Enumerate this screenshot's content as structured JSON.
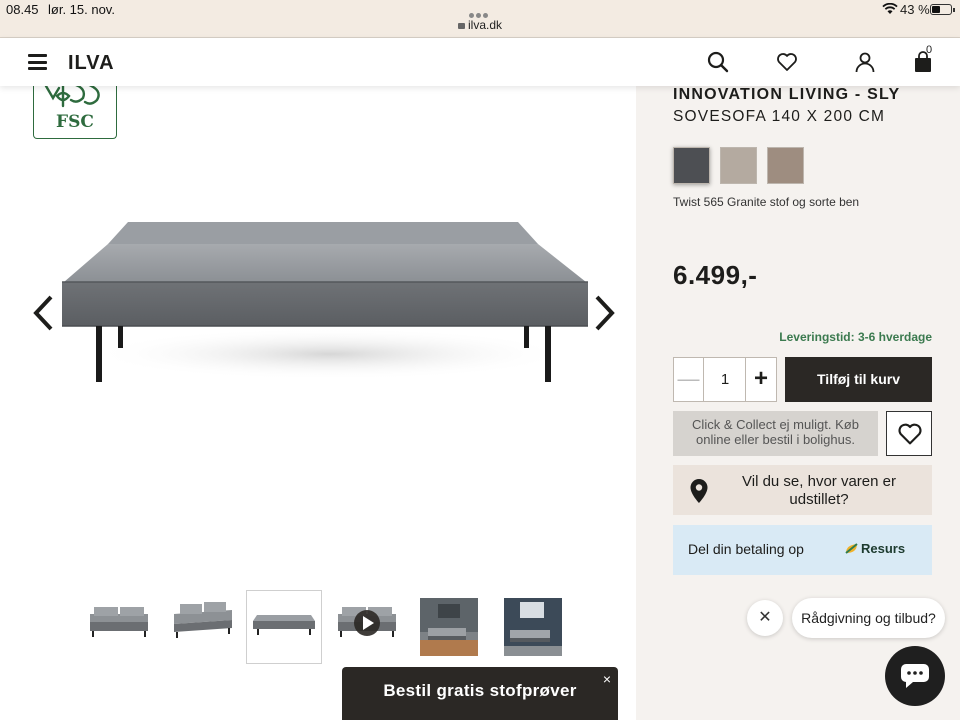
{
  "status": {
    "time": "08.45",
    "date": "lør. 15. nov.",
    "url": "ilva.dk",
    "battery": "43 %"
  },
  "header": {
    "logo": "ILVA",
    "cart_count": "0",
    "icons": [
      "menu-icon",
      "search-icon",
      "heart-icon",
      "user-icon",
      "bag-icon"
    ]
  },
  "gallery": {
    "fsc_label": "FSC",
    "thumbnails": [
      "sofa-front",
      "sofa-angle",
      "sofa-bed-flat",
      "video",
      "room-photo",
      "room-photo-dark"
    ],
    "selected_thumbnail": 2,
    "promo_label": "Bestil gratis stofprøver",
    "promo_close": "×"
  },
  "product": {
    "brand": "INNOVATION LIVING - SLY",
    "title": "SOVESOFA 140 X 200 CM",
    "swatches": [
      "#4d4f53",
      "#b4aaa0",
      "#9e8d80"
    ],
    "color_name": "Twist 565 Granite stof og sorte ben",
    "price": "6.499,-",
    "delivery": "Leveringstid: 3-6 hverdage",
    "quantity": "1",
    "minus": "—",
    "plus": "+",
    "add_to_cart": "Tilføj til kurv",
    "click_collect": "Click & Collect ej muligt. Køb online eller bestil i bolighus.",
    "showroom": "Vil du se, hvor varen er udstillet?",
    "payment": "Del din betaling op",
    "payment_logo": "Resurs"
  },
  "chat": {
    "close": "✕",
    "bubble": "Rådgivning og tilbud?"
  }
}
